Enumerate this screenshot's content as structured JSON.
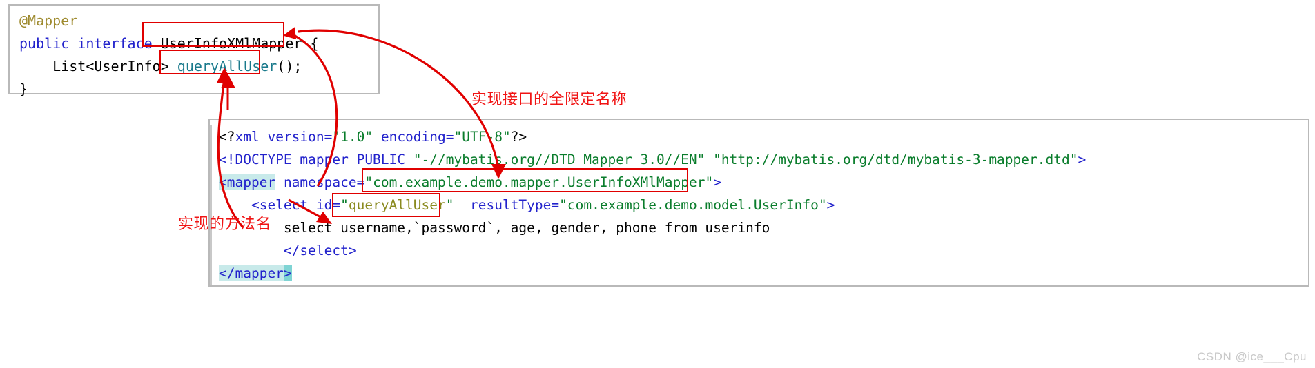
{
  "java_block": {
    "lines": [
      {
        "id": "l1",
        "parts": [
          {
            "t": "@Mapper",
            "c": "ann"
          }
        ]
      },
      {
        "id": "l2",
        "parts": [
          {
            "t": "public",
            "c": "kw"
          },
          {
            "t": " ",
            "c": "plain"
          },
          {
            "t": "interface",
            "c": "kw"
          },
          {
            "t": " ",
            "c": "plain"
          },
          {
            "t": "UserInfoXMlMapper",
            "c": "type"
          },
          {
            "t": " {",
            "c": "plain"
          }
        ]
      },
      {
        "id": "l3",
        "parts": [
          {
            "t": "    List<UserInfo> ",
            "c": "plain"
          },
          {
            "t": "queryAllUser",
            "c": "method"
          },
          {
            "t": "();",
            "c": "plain"
          }
        ]
      },
      {
        "id": "l4",
        "parts": [
          {
            "t": "}",
            "c": "plain"
          }
        ]
      }
    ]
  },
  "xml_block": {
    "lines": [
      {
        "id": "x1",
        "parts": [
          {
            "t": "<?",
            "c": "punc"
          },
          {
            "t": "xml",
            "c": "attr"
          },
          {
            "t": " version=",
            "c": "attr"
          },
          {
            "t": "\"1.0\"",
            "c": "str"
          },
          {
            "t": " encoding=",
            "c": "attr"
          },
          {
            "t": "\"UTF-8\"",
            "c": "str"
          },
          {
            "t": "?>",
            "c": "punc"
          }
        ]
      },
      {
        "id": "x2",
        "parts": [
          {
            "t": "<!DOCTYPE mapper PUBLIC ",
            "c": "attr"
          },
          {
            "t": "\"-//mybatis.org//DTD Mapper 3.0//EN\"",
            "c": "str"
          },
          {
            "t": " ",
            "c": "plain"
          },
          {
            "t": "\"http://mybatis.org/dtd/mybatis-3-mapper.dtd\"",
            "c": "str"
          },
          {
            "t": ">",
            "c": "tag"
          }
        ]
      },
      {
        "id": "x3",
        "parts": [
          {
            "t": "<",
            "c": "tag",
            "hl": "cyan"
          },
          {
            "t": "mapper",
            "c": "tag",
            "hl": "cyan"
          },
          {
            "t": " namespace=",
            "c": "attr"
          },
          {
            "t": "\"",
            "c": "str"
          },
          {
            "t": "com.example.demo.mapper.UserInfoXMlMapper",
            "c": "str"
          },
          {
            "t": "\"",
            "c": "str"
          },
          {
            "t": ">",
            "c": "tag"
          }
        ]
      },
      {
        "id": "x4",
        "parts": [
          {
            "t": "    <",
            "c": "tag"
          },
          {
            "t": "select",
            "c": "tag"
          },
          {
            "t": " id=",
            "c": "attr"
          },
          {
            "t": "\"",
            "c": "str"
          },
          {
            "t": "queryAllUser",
            "c": "olive"
          },
          {
            "t": "\"",
            "c": "str"
          },
          {
            "t": "  resultType=",
            "c": "attr"
          },
          {
            "t": "\"com.example.demo.model.UserInfo\"",
            "c": "str"
          },
          {
            "t": ">",
            "c": "tag"
          }
        ]
      },
      {
        "id": "x5",
        "sql": "        select username,`password`, age, gender, phone from userinfo"
      },
      {
        "id": "x6",
        "parts": [
          {
            "t": "        </",
            "c": "tag"
          },
          {
            "t": "select",
            "c": "tag"
          },
          {
            "t": ">",
            "c": "tag"
          }
        ]
      },
      {
        "id": "x7",
        "parts": [
          {
            "t": "</",
            "c": "tag",
            "hl": "cyan"
          },
          {
            "t": "mapper",
            "c": "tag",
            "hl": "cyan"
          },
          {
            "t": ">",
            "c": "tag",
            "hl": "cursor"
          }
        ]
      }
    ]
  },
  "annotations": {
    "label_interface": "实现接口的全限定名称",
    "label_method": "实现的方法名"
  },
  "watermark": {
    "text": "CSDN @ice___Cpu"
  },
  "colors": {
    "annotation_red": "#f01414",
    "box_red": "#e00000",
    "string_green": "#0a7d2c",
    "keyword_blue": "#2222cc",
    "highlight_cyan": "#c8eaea"
  }
}
